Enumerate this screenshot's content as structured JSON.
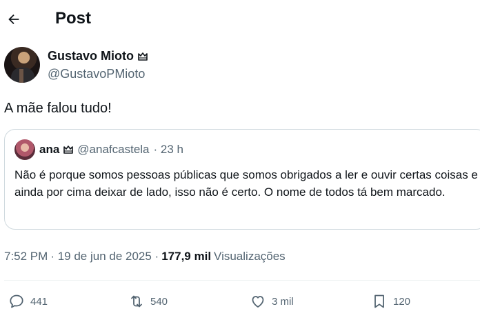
{
  "header": {
    "title": "Post",
    "back_icon": "arrow-left-icon"
  },
  "author": {
    "name": "Gustavo Mioto",
    "handle": "@GustavoPMioto",
    "badge_icon": "crown-badge-icon"
  },
  "post": {
    "text": "A mãe falou tudo!"
  },
  "quote": {
    "name": "ana",
    "handle": "@anafcastela",
    "time": "· 23 h",
    "text": "Não é porque somos pessoas públicas que somos obrigados a ler e ouvir certas coisas e ainda por cima deixar de lado, isso não é certo. O nome de todos tá bem marcado."
  },
  "meta": {
    "time": "7:52 PM",
    "date": "· 19 de jun de 2025 ·",
    "views_count": "177,9 mil",
    "views_label": "Visualizações"
  },
  "actions": {
    "replies": "441",
    "reposts": "540",
    "likes": "3 mil",
    "bookmarks": "120"
  },
  "colors": {
    "text": "#0f1419",
    "secondary": "#536471",
    "border": "#cfd9de"
  }
}
